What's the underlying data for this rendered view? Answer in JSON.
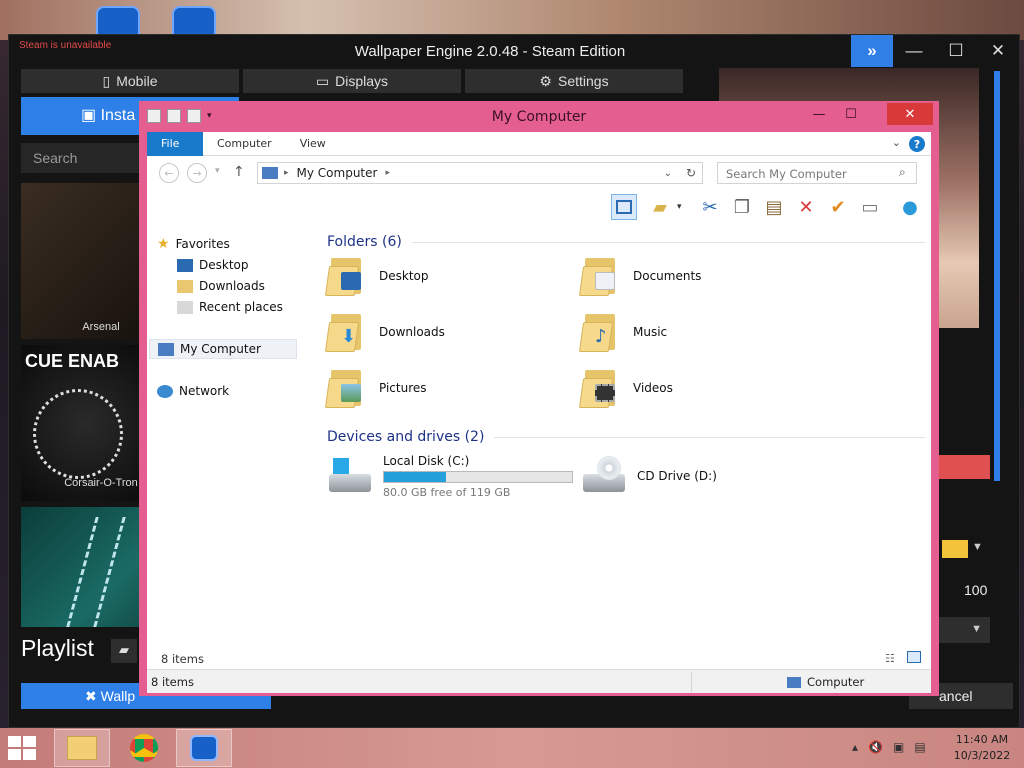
{
  "wallpaper_engine": {
    "title": "Wallpaper Engine 2.0.48 - Steam Edition",
    "steam_status": "Steam is unavailable",
    "tabs": [
      "Mobile",
      "Displays",
      "Settings"
    ],
    "install_label": "Insta",
    "search_placeholder": "Search",
    "tiles": [
      {
        "label": "Arsenal"
      },
      {
        "label": "Corsair-O-Tron",
        "overlay": "CUE ENAB"
      }
    ],
    "playlist_label": "Playlist",
    "wallpaper_button": "Wallp",
    "cancel_button": "ancel",
    "value_100": "100",
    "accent": "#2e7fe8",
    "swatch": "#f3c43a"
  },
  "explorer": {
    "title": "My Computer",
    "ribbon_tabs": [
      "File",
      "Computer",
      "View"
    ],
    "address": "My Computer",
    "search_placeholder": "Search My Computer",
    "nav": {
      "favorites": "Favorites",
      "desktop": "Desktop",
      "downloads": "Downloads",
      "recent": "Recent places",
      "my_computer": "My Computer",
      "network": "Network"
    },
    "folders_header": "Folders (6)",
    "folders": [
      "Desktop",
      "Documents",
      "Downloads",
      "Music",
      "Pictures",
      "Videos"
    ],
    "drives_header": "Devices and drives (2)",
    "drives": [
      {
        "name": "Local Disk (C:)",
        "free": "80.0 GB free of 119 GB",
        "used_fraction": 0.33
      },
      {
        "name": "CD Drive (D:)"
      }
    ],
    "item_count": "8 items",
    "status_items": "8 items",
    "status_location": "Computer"
  },
  "taskbar": {
    "time": "11:40 AM",
    "date": "10/3/2022"
  }
}
